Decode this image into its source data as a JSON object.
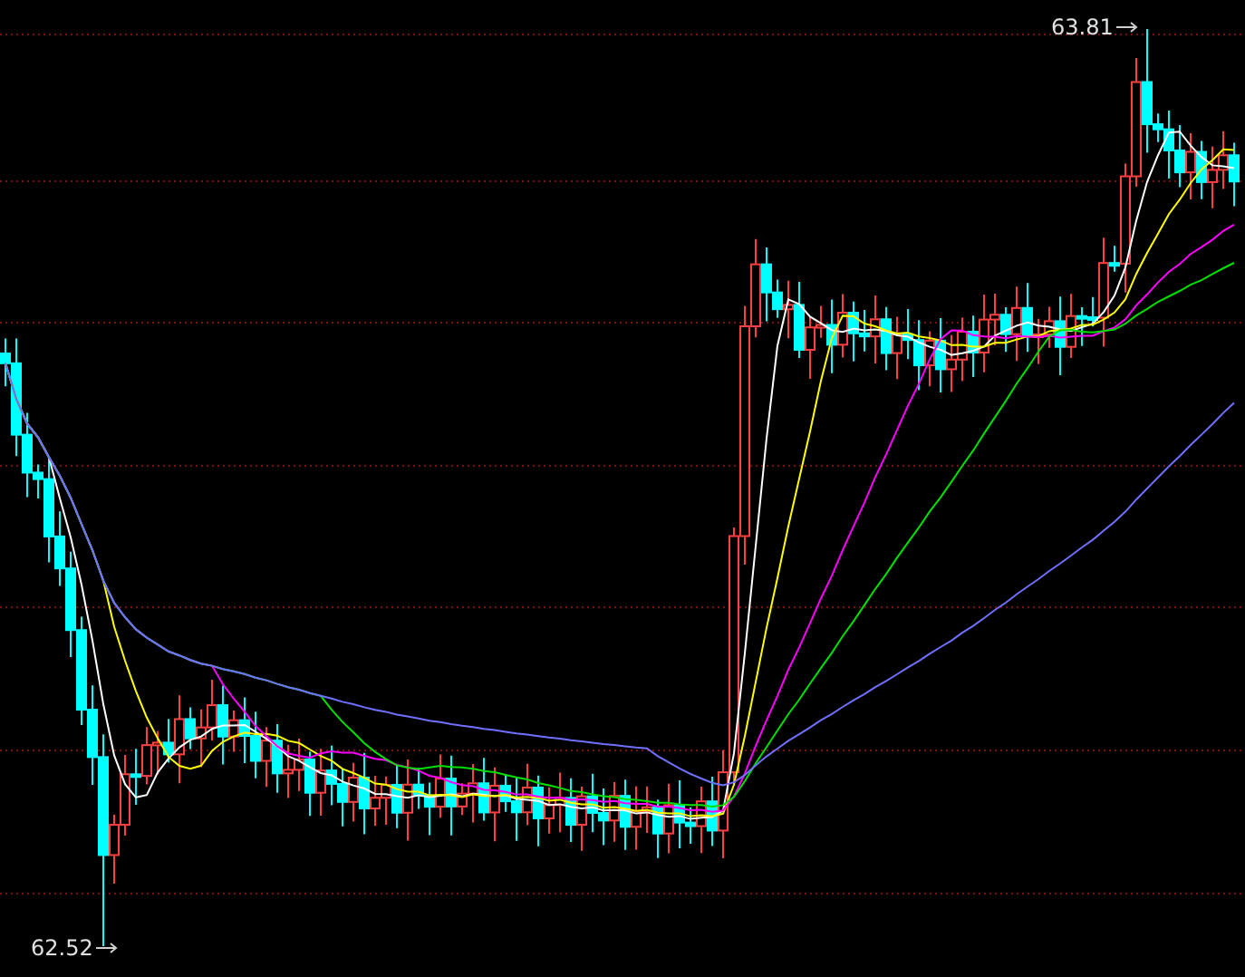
{
  "chart": {
    "high_label": "63.81",
    "low_label": "62.52"
  }
}
